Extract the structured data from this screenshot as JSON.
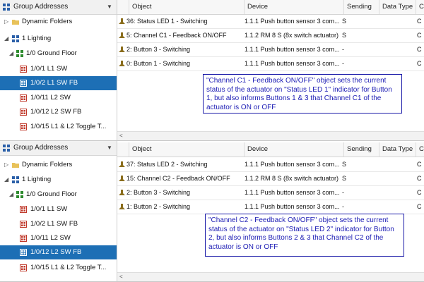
{
  "colors": {
    "selection": "#1d6fb5",
    "note_text": "#1c1cb4",
    "note_border": "#1a1aa8",
    "group_icon_red": "#c0392b",
    "folder_green": "#2e8b2e"
  },
  "panes": [
    {
      "tree": {
        "header": "Group Addresses",
        "nodes": [
          {
            "label": "Dynamic Folders",
            "icon": "folder-icon"
          },
          {
            "label": "1 Lighting",
            "icon": "group-grid-icon"
          },
          {
            "label": "1/0 Ground Floor",
            "icon": "group-grid-icon"
          },
          {
            "label": "1/0/1 L1 SW",
            "icon": "group-address-icon"
          },
          {
            "label": "1/0/2 L1 SW FB",
            "icon": "group-address-icon"
          },
          {
            "label": "1/0/11 L2 SW",
            "icon": "group-address-icon"
          },
          {
            "label": "1/0/12 L2 SW FB",
            "icon": "group-address-icon"
          },
          {
            "label": "1/0/15 L1 & L2 Toggle T...",
            "icon": "group-address-icon"
          }
        ]
      },
      "table": {
        "columns": [
          "Object",
          "Device",
          "Sending",
          "Data Type",
          "C"
        ],
        "rows": [
          {
            "object": "36: Status LED 1 - Switching",
            "device": "1.1.1 Push button sensor 3 com...",
            "sending": "S",
            "data_type": "",
            "c": "C"
          },
          {
            "object": "5: Channel C1 - Feedback ON/OFF",
            "device": "1.1.2 RM 8 S (8x switch actuator)",
            "sending": "S",
            "data_type": "",
            "c": "C"
          },
          {
            "object": "2: Button 3 - Switching",
            "device": "1.1.1 Push button sensor 3 com...",
            "sending": "-",
            "data_type": "",
            "c": "C"
          },
          {
            "object": "0: Button 1 - Switching",
            "device": "1.1.1 Push button sensor 3 com...",
            "sending": "-",
            "data_type": "",
            "c": "C"
          }
        ],
        "note": "\"Channel C1 - Feedback ON/OFF\" object sets the current status of the actuator on \"Status LED 1\" indicator for Button 1, but also informs Buttons 1 & 3 that Channel C1 of the actuator is ON or OFF"
      }
    },
    {
      "tree": {
        "header": "Group Addresses",
        "nodes": [
          {
            "label": "Dynamic Folders",
            "icon": "folder-icon"
          },
          {
            "label": "1 Lighting",
            "icon": "group-grid-icon"
          },
          {
            "label": "1/0 Ground Floor",
            "icon": "group-grid-icon"
          },
          {
            "label": "1/0/1 L1 SW",
            "icon": "group-address-icon"
          },
          {
            "label": "1/0/2 L1 SW FB",
            "icon": "group-address-icon"
          },
          {
            "label": "1/0/11 L2 SW",
            "icon": "group-address-icon"
          },
          {
            "label": "1/0/12 L2 SW FB",
            "icon": "group-address-icon"
          },
          {
            "label": "1/0/15 L1 & L2 Toggle T...",
            "icon": "group-address-icon"
          }
        ]
      },
      "table": {
        "columns": [
          "Object",
          "Device",
          "Sending",
          "Data Type",
          "C"
        ],
        "rows": [
          {
            "object": "37: Status LED 2 - Switching",
            "device": "1.1.1 Push button sensor 3 com...",
            "sending": "S",
            "data_type": "",
            "c": "C"
          },
          {
            "object": "15: Channel C2 - Feedback ON/OFF",
            "device": "1.1.2 RM 8 S (8x switch actuator)",
            "sending": "S",
            "data_type": "",
            "c": "C"
          },
          {
            "object": "2: Button 3 - Switching",
            "device": "1.1.1 Push button sensor 3 com...",
            "sending": "-",
            "data_type": "",
            "c": "C"
          },
          {
            "object": "1: Button 2 - Switching",
            "device": "1.1.1 Push button sensor 3 com...",
            "sending": "-",
            "data_type": "",
            "c": "C"
          }
        ],
        "note": "\"Channel C2 - Feedback ON/OFF\" object sets the current status of the actuator on \"Status LED 2\" indicator for Button 2, but also informs Buttons 2 & 3 that Channel C2 of the actuator is ON or OFF"
      }
    }
  ]
}
